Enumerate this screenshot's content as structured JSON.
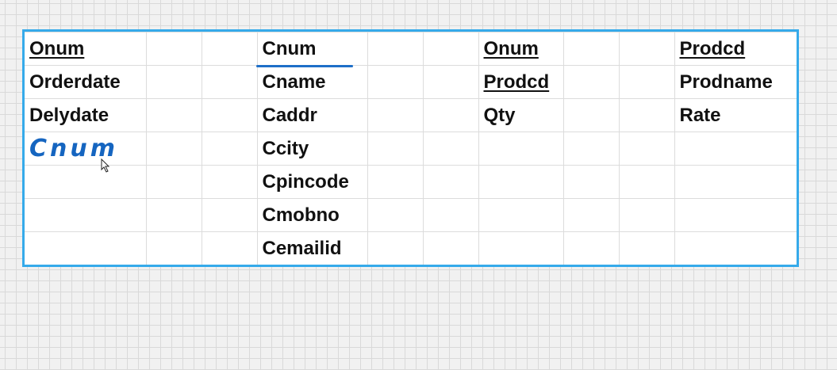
{
  "columns": [
    {
      "cells": [
        {
          "text": "Onum",
          "underline": true
        },
        {
          "text": "Orderdate"
        },
        {
          "text": "Delydate"
        },
        {
          "text": "Cnum",
          "handwritten": true
        }
      ]
    },
    {
      "cells": []
    },
    {
      "cells": []
    },
    {
      "cells": [
        {
          "text": "Cnum"
        },
        {
          "text": "Cname"
        },
        {
          "text": "Caddr"
        },
        {
          "text": "Ccity"
        },
        {
          "text": "Cpincode"
        },
        {
          "text": "Cmobno"
        },
        {
          "text": "Cemailid"
        }
      ]
    },
    {
      "cells": []
    },
    {
      "cells": []
    },
    {
      "cells": [
        {
          "text": "Onum",
          "underline": true
        },
        {
          "text": "Prodcd",
          "underline": true
        },
        {
          "text": "Qty"
        }
      ]
    },
    {
      "cells": []
    },
    {
      "cells": []
    },
    {
      "cells": [
        {
          "text": "Prodcd",
          "underline": true
        },
        {
          "text": "Prodname"
        },
        {
          "text": "Rate"
        }
      ]
    }
  ],
  "colors": {
    "border": "#35aaea",
    "ink": "#1565c0"
  }
}
